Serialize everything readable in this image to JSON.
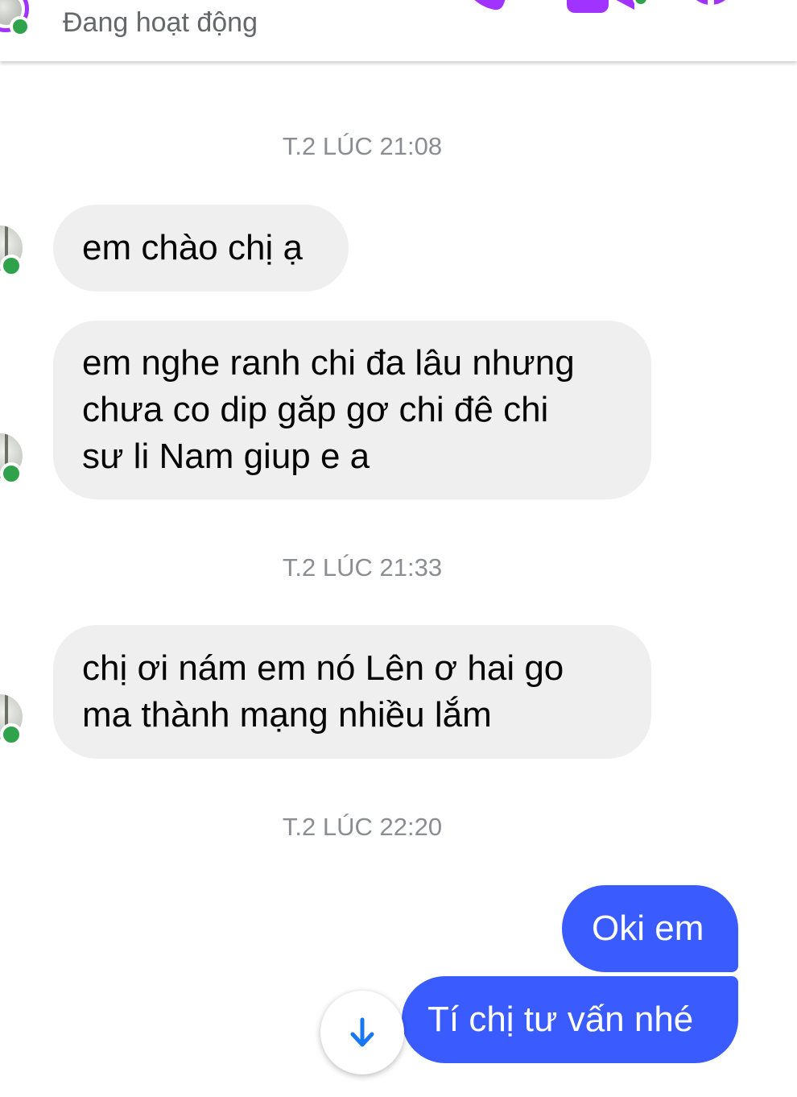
{
  "header": {
    "status": "Đang hoạt động",
    "icons": [
      "phone-icon",
      "video-camera-icon",
      "info-icon"
    ]
  },
  "colors": {
    "accent": "#a033ff",
    "outgoing_bubble": "#3a5cff",
    "incoming_bubble": "#efefef",
    "online": "#31a24c",
    "timestamp": "#8a8d91"
  },
  "thread": {
    "timestamps": [
      "T.2 LÚC 21:08",
      "T.2 LÚC 21:33",
      "T.2 LÚC 22:20"
    ],
    "incoming": [
      {
        "lines": [
          "em chào chị ạ"
        ]
      },
      {
        "lines": [
          "em nghe ranh chi đa lâu nhưng",
          "chưa co dip găp gơ chi đê chi",
          "sư li Nam giup e a"
        ]
      },
      {
        "lines": [
          "chị ơi nám em nó Lên ơ hai go",
          "ma thành mạng nhiều lắm"
        ]
      }
    ],
    "outgoing": [
      {
        "text": "Oki em"
      },
      {
        "text": "Tí chị tư vấn nhé"
      }
    ]
  },
  "scroll_button": {
    "icon": "arrow-down-icon"
  }
}
